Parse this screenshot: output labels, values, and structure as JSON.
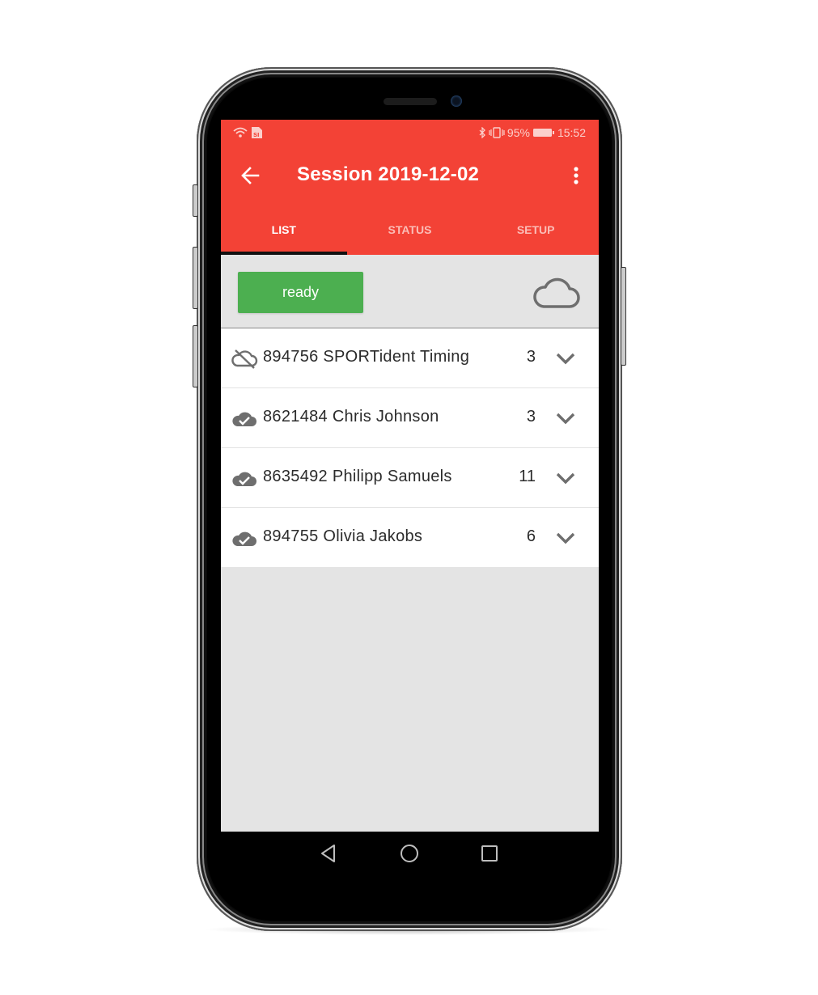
{
  "status_bar": {
    "left_icons": [
      "wifi-icon",
      "sim-icon"
    ],
    "right_icons": [
      "bluetooth-icon",
      "vibrate-icon"
    ],
    "battery_percent": "95%",
    "time": "15:52"
  },
  "toolbar": {
    "back_icon": "arrow-left-icon",
    "title": "Session 2019-12-02",
    "menu_icon": "more-vert-icon"
  },
  "tabs": [
    {
      "label": "LIST",
      "active": true
    },
    {
      "label": "STATUS",
      "active": false
    },
    {
      "label": "SETUP",
      "active": false
    }
  ],
  "ready_bar": {
    "button_label": "ready",
    "button_color": "#4caf50",
    "cloud_icon": "cloud-outline-icon"
  },
  "list": [
    {
      "label": "894756 SPORTident Timing",
      "count": "3",
      "sync_icon": "cloud-off-icon"
    },
    {
      "label": "8621484 Chris Johnson",
      "count": "3",
      "sync_icon": "cloud-check-icon"
    },
    {
      "label": "8635492 Philipp Samuels",
      "count": "11",
      "sync_icon": "cloud-check-icon"
    },
    {
      "label": "894755 Olivia Jakobs",
      "count": "6",
      "sync_icon": "cloud-check-icon"
    }
  ],
  "nav_bar": {
    "buttons": [
      "back-triangle-icon",
      "home-circle-icon",
      "recents-square-icon"
    ]
  },
  "colors": {
    "accent": "#f34236",
    "success": "#4caf50",
    "tab_indicator": "#111111"
  }
}
